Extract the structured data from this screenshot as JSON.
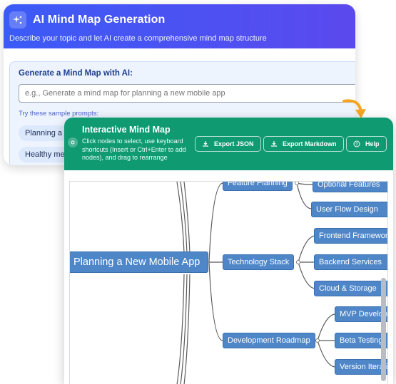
{
  "generator": {
    "title": "AI Mind Map Generation",
    "subtitle": "Describe your topic and let AI create a comprehensive mind map structure",
    "form_title": "Generate a Mind Map with AI:",
    "input_placeholder": "e.g., Generate a mind map for planning a new mobile app",
    "sample_label": "Try these sample prompts:",
    "samples": [
      "Planning a",
      "Healthy me"
    ]
  },
  "mindmap_panel": {
    "title": "Interactive Mind Map",
    "description": "Click nodes to select, use keyboard shortcuts (Insert or Ctrl+Enter to add nodes), and drag to rearrange",
    "buttons": {
      "export_json": "Export JSON",
      "export_markdown": "Export Markdown",
      "help": "Help"
    },
    "root": "Planning a New Mobile App",
    "branches": [
      {
        "label": "Feature Planning",
        "children": [
          "Optional Features",
          "User Flow Design"
        ]
      },
      {
        "label": "Technology Stack",
        "children": [
          "Frontend Framework",
          "Backend Services",
          "Cloud & Storage"
        ]
      },
      {
        "label": "Development Roadmap",
        "children": [
          "MVP Development",
          "Beta Testing",
          "Version Iteration"
        ]
      }
    ]
  },
  "colors": {
    "generator_header": "#4552f2",
    "mindmap_header": "#0f9a72",
    "node_fill": "#4e86c8",
    "arrow": "#f5a524"
  }
}
